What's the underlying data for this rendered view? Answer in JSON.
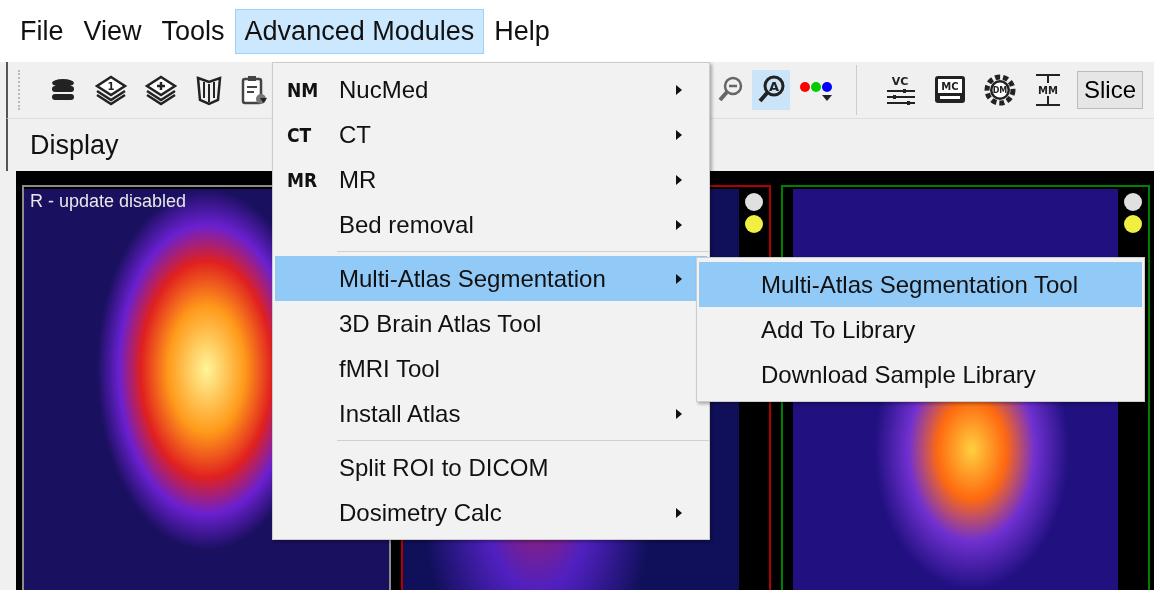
{
  "menu_bar": [
    {
      "label": "File",
      "selected": false
    },
    {
      "label": "View",
      "selected": false
    },
    {
      "label": "Tools",
      "selected": false
    },
    {
      "label": "Advanced Modules",
      "selected": true
    },
    {
      "label": "Help",
      "selected": false
    }
  ],
  "toolbar": {
    "left_tools": [
      {
        "kind": "database"
      },
      {
        "kind": "layers",
        "label": "1"
      },
      {
        "kind": "layers-add"
      },
      {
        "kind": "shield"
      },
      {
        "kind": "clipboard"
      }
    ],
    "middle_tools": [
      {
        "kind": "zoom-out",
        "selected": false
      },
      {
        "kind": "zoom-letter",
        "label": "A",
        "selected": true
      },
      {
        "kind": "color-dots",
        "selected": false
      }
    ],
    "right_tools": [
      {
        "kind": "sliders",
        "label": "VC"
      },
      {
        "kind": "screen",
        "label": "MC"
      },
      {
        "kind": "gear",
        "label": "DM"
      },
      {
        "kind": "measure",
        "label": "MM"
      }
    ],
    "slice_button": "Slice"
  },
  "display_label": "Display",
  "viewports": [
    {
      "color": "#8c8c8c",
      "caption": "R - update disabled"
    },
    {
      "color": "#b00000",
      "dots": [
        {
          "color": "#e0e0e0"
        },
        {
          "color": "#f0f040"
        }
      ]
    },
    {
      "color": "#008000",
      "dots": [
        {
          "color": "#e0e0e0"
        },
        {
          "color": "#f0f040"
        }
      ]
    }
  ],
  "menu": {
    "groups": [
      [
        {
          "icon_text": "NM",
          "label": "NucMed",
          "submenu": true,
          "selected": false
        },
        {
          "icon_text": "CT",
          "label": "CT",
          "submenu": true,
          "selected": false
        },
        {
          "icon_text": "MR",
          "label": "MR",
          "submenu": true,
          "selected": false
        },
        {
          "label": "Bed removal",
          "submenu": true,
          "selected": false
        }
      ],
      [
        {
          "label": "Multi-Atlas Segmentation",
          "submenu": true,
          "selected": true
        },
        {
          "label": "3D Brain Atlas Tool",
          "submenu": false,
          "selected": false
        },
        {
          "label": "fMRI Tool",
          "submenu": false,
          "selected": false
        },
        {
          "label": "Install Atlas",
          "submenu": true,
          "selected": false
        }
      ],
      [
        {
          "label": "Split ROI to DICOM",
          "submenu": false,
          "selected": false
        },
        {
          "label": "Dosimetry Calc",
          "submenu": true,
          "selected": false
        }
      ]
    ]
  },
  "submenu": [
    {
      "label": "Multi-Atlas Segmentation Tool",
      "selected": true
    },
    {
      "label": "Add To Library",
      "selected": false
    },
    {
      "label": "Download Sample Library",
      "selected": false
    }
  ]
}
